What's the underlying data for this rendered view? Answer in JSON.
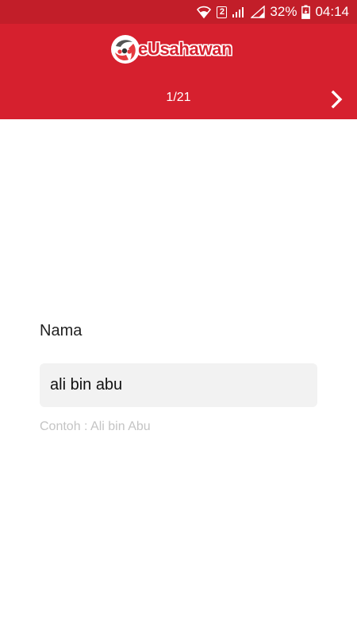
{
  "status_bar": {
    "sim_slot": "2",
    "battery_percent": "32%",
    "time": "04:14",
    "icons": [
      "wifi-icon",
      "sim-2-icon",
      "signal-icon",
      "signal-icon",
      "battery-charging-icon"
    ]
  },
  "header": {
    "logo_text": "eUsahawan",
    "page_counter": "1/21",
    "next_icon": "chevron-right-icon",
    "background_color": "#d6202e"
  },
  "form": {
    "field_label": "Nama",
    "field_value": "ali bin abu",
    "field_hint": "Contoh : Ali bin Abu"
  }
}
